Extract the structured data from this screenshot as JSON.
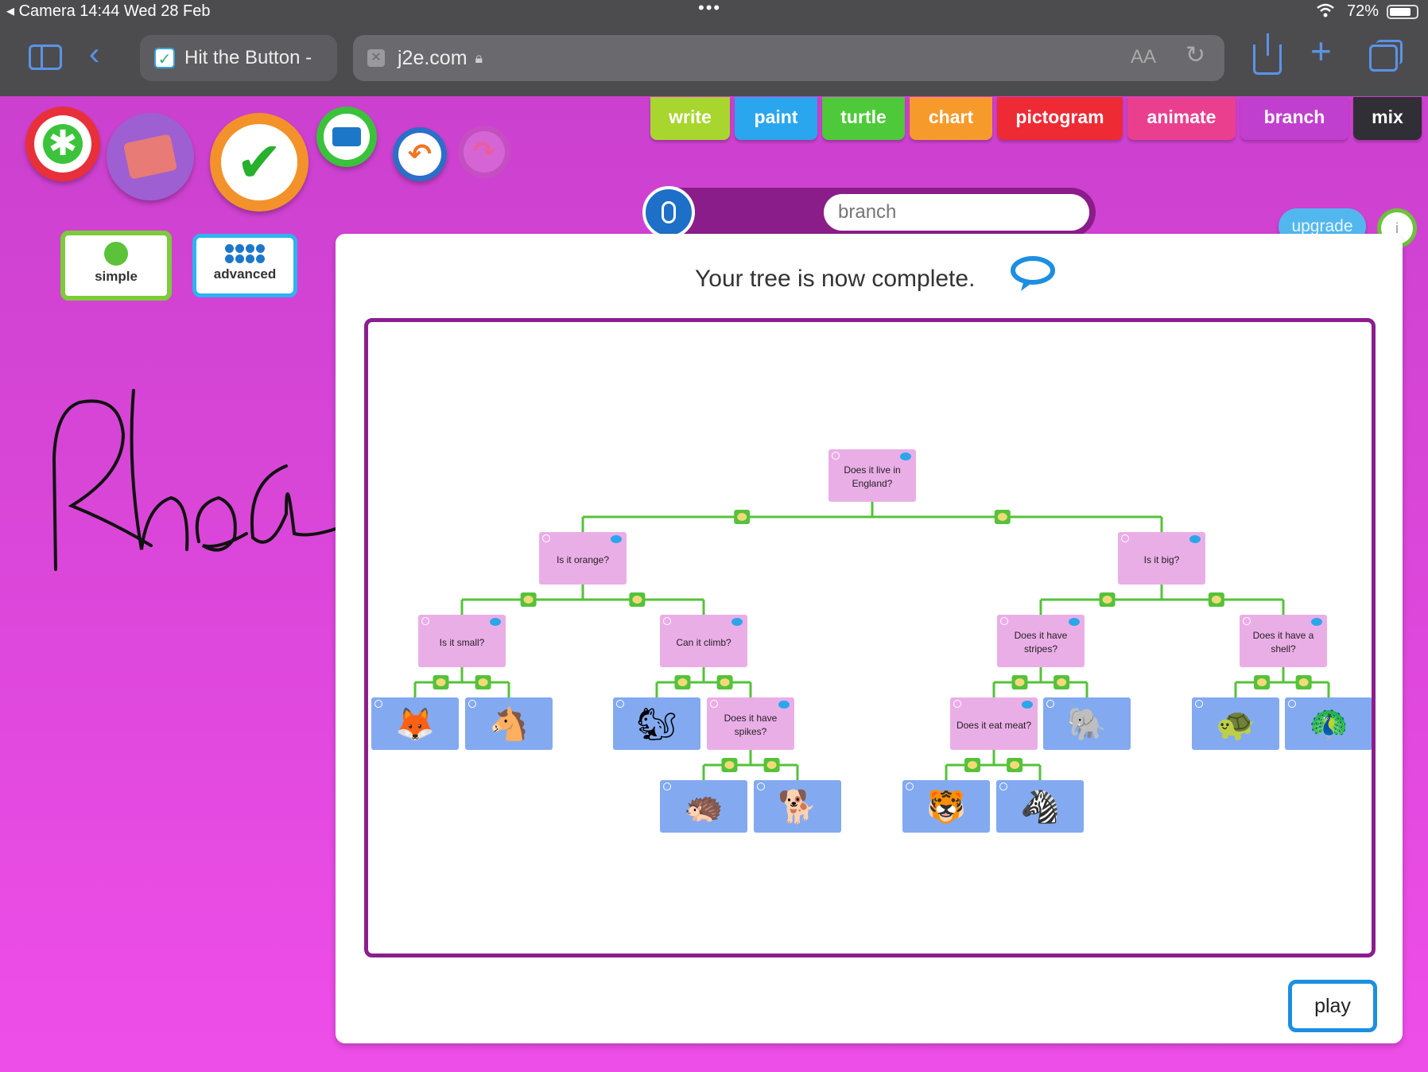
{
  "status_bar": {
    "left": "◂ Camera   14:44   Wed 28 Feb",
    "dots": "•••",
    "battery": "72%"
  },
  "browser": {
    "tab_title": "Hit the Button -",
    "url": "j2e.com",
    "text_size": "AA"
  },
  "toolbar": {
    "simple_label": "simple",
    "advanced_label": "advanced"
  },
  "app_tabs": [
    {
      "label": "write",
      "color": "#a8d62e"
    },
    {
      "label": "paint",
      "color": "#2aa6ee"
    },
    {
      "label": "turtle",
      "color": "#4ec93a"
    },
    {
      "label": "chart",
      "color": "#f79a2c"
    },
    {
      "label": "pictogram",
      "color": "#ee2a35"
    },
    {
      "label": "animate",
      "color": "#ea3f8f"
    },
    {
      "label": "branch",
      "color": "#c03fcf"
    },
    {
      "label": "mix",
      "color": "#2f2f35"
    }
  ],
  "search": {
    "placeholder": "branch"
  },
  "upgrade_label": "upgrade",
  "info_label": "i",
  "panel": {
    "message": "Your tree is now complete.",
    "play_label": "play"
  },
  "tree": {
    "questions": {
      "root": "Does it live in England?",
      "orange": "Is it orange?",
      "big": "Is it big?",
      "small": "Is it small?",
      "climb": "Can it climb?",
      "stripes": "Does it have stripes?",
      "shell": "Does it have a shell?",
      "spikes": "Does it have spikes?",
      "meat": "Does it eat meat?"
    },
    "answers": {
      "fox": "🦊",
      "horse": "🐴",
      "squirrel": "🐿",
      "hedgehog": "🦔",
      "dog": "🐕",
      "tiger": "🐯",
      "zebra": "🦓",
      "elephant": "🐘",
      "turtle": "🐢",
      "peacock": "🦚"
    }
  },
  "signature_text": "Rhea"
}
